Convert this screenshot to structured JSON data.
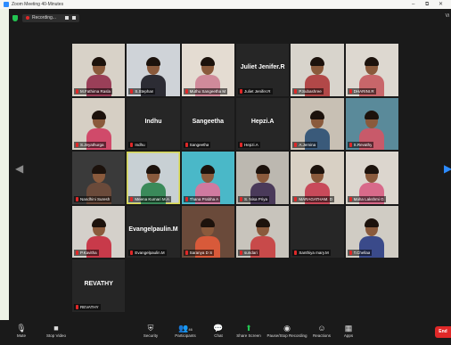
{
  "window": {
    "title": "Zoom Meeting 40-Minutes",
    "minimize": "–",
    "restore": "⧉",
    "close": "✕"
  },
  "header": {
    "recording_label": "Recording...",
    "view_label": "Vi"
  },
  "nav": {
    "prev": "◀",
    "next": "▶"
  },
  "participants": [
    {
      "name": "M.Fathima Rasla",
      "video": true,
      "bg": "#d8d2c8",
      "shirt": "#9a3f58"
    },
    {
      "name": "S.Stephan",
      "video": true,
      "bg": "#cfd3d8",
      "shirt": "#2c2c34"
    },
    {
      "name": "Muthu Sangeetha M",
      "video": true,
      "bg": "#e4dcd2",
      "shirt": "#d08a9a"
    },
    {
      "name": "Juliet Jenifer.R",
      "video": false,
      "label": "Juliet Jenifer.R"
    },
    {
      "name": "P.Subashree",
      "video": true,
      "bg": "#d8d4cc",
      "shirt": "#b24848"
    },
    {
      "name": "DHARINI.R",
      "video": true,
      "bg": "#ddd8d0",
      "shirt": "#c8666a"
    },
    {
      "name": "S.Jeyathurga",
      "video": true,
      "bg": "#d6cfc4",
      "shirt": "#d04a6a"
    },
    {
      "name": "Indhu",
      "video": false,
      "label": "Indhu"
    },
    {
      "name": "Sangeetha",
      "video": false,
      "label": "Sangeetha"
    },
    {
      "name": "Hepzi.A",
      "video": false,
      "label": "Hepzi.A"
    },
    {
      "name": "A.Jemina",
      "video": true,
      "bg": "#c8c0b4",
      "shirt": "#3a5a7a"
    },
    {
      "name": "S.Revathy",
      "video": true,
      "bg": "#5a8a9a",
      "shirt": "#c85a6a"
    },
    {
      "name": "Nandhini Suresh",
      "video": true,
      "bg": "#3a3a3a",
      "shirt": "#6a4a3a"
    },
    {
      "name": "Meena Kumari M.A",
      "video": true,
      "bg": "#c8d0d4",
      "shirt": "#3a8a5a",
      "speaking": true
    },
    {
      "name": "Thana Prabha A",
      "video": true,
      "bg": "#4ab8c8",
      "shirt": "#d07aa0"
    },
    {
      "name": "S. Nisa Priya",
      "video": true,
      "bg": "#bcb8b0",
      "shirt": "#4a3a5a"
    },
    {
      "name": "MARAGATHAM. D",
      "video": true,
      "bg": "#d8d0c4",
      "shirt": "#c84a5a"
    },
    {
      "name": "Maha Lakshmi G",
      "video": true,
      "bg": "#dcd6ce",
      "shirt": "#d86a8a"
    },
    {
      "name": "P.Kavitha",
      "video": true,
      "bg": "#d4d0ca",
      "shirt": "#c83a4a"
    },
    {
      "name": "Evangelpaulin.M",
      "video": false,
      "label": "Evangelpaulin.M"
    },
    {
      "name": "Saranya D S",
      "video": true,
      "bg": "#6a4a3a",
      "shirt": "#d85a3a"
    },
    {
      "name": "sundari",
      "video": true,
      "bg": "#c8c4bc",
      "shirt": "#c84a4a"
    },
    {
      "name": "Santhiya mary.M",
      "video": false,
      "label": ""
    },
    {
      "name": "T.Chellaa",
      "video": true,
      "bg": "#d0ccc4",
      "shirt": "#3a4a8a"
    },
    {
      "name": "REVATHY",
      "video": false,
      "label": "REVATHY"
    }
  ],
  "toolbar": {
    "mute": "Mute",
    "stop_video": "Stop Video",
    "security": "Security",
    "participants": "Participants",
    "participants_count": "46",
    "chat": "Chat",
    "share_screen": "Share Screen",
    "record": "Pause/Stop Recording",
    "reactions": "Reactions",
    "apps": "Apps",
    "end": "End"
  }
}
